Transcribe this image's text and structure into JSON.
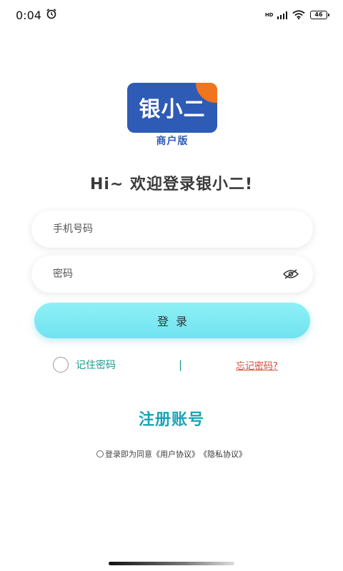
{
  "status_bar": {
    "time": "0:04",
    "network_badge": "HD",
    "battery": "46"
  },
  "logo": {
    "title": "银小二",
    "subtitle": "商户版"
  },
  "greeting": "Hi~ 欢迎登录银小二!",
  "form": {
    "phone_placeholder": "手机号码",
    "phone_value": "",
    "password_placeholder": "密码",
    "password_value": "",
    "login_label": "登录",
    "remember_label": "记住密码",
    "divider": "|",
    "forgot_label": "忘记密码?"
  },
  "register_label": "注册账号",
  "agreement": {
    "prefix": "登录即为同意",
    "user_agreement": "《用户协议》",
    "privacy_policy": "《隐私协议》"
  },
  "colors": {
    "brand_blue": "#2e5bb5",
    "brand_orange": "#f0751e",
    "accent_teal": "#1aa3b8",
    "button_cyan": "#7fe9f3",
    "forgot_red": "#d94a3a"
  }
}
